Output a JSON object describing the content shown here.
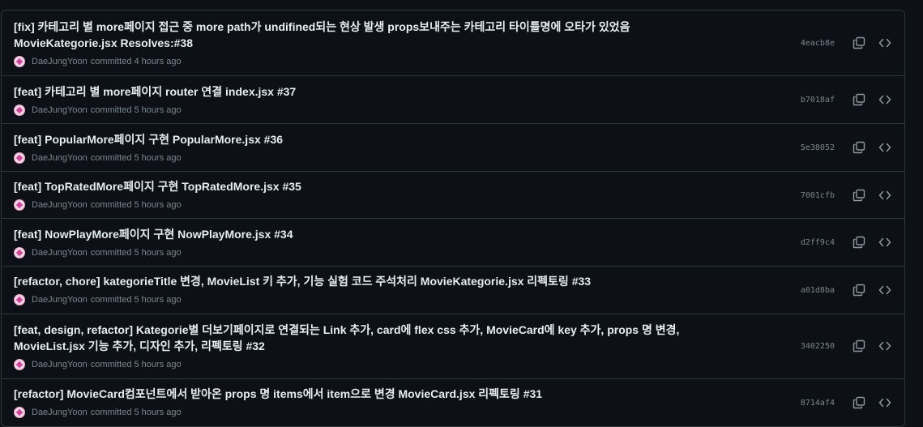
{
  "commits": [
    {
      "title_line1": "[fix] 카테고리 별 more페이지 접근 중 more path가 undifined되는 현상 발생 props보내주는 카테고리 타이틀명에 오타가 있었음",
      "title_line2": "MovieKategorie.jsx Resolves:#38",
      "author": "DaeJungYoon",
      "committed": "committed 4 hours ago",
      "sha": "4eacb8e"
    },
    {
      "title_line1": "[feat] 카테고리 별 more페이지 router 연결 index.jsx #37",
      "title_line2": "",
      "author": "DaeJungYoon",
      "committed": "committed 5 hours ago",
      "sha": "b7018af"
    },
    {
      "title_line1": "[feat] PopularMore페이지 구현 PopularMore.jsx #36",
      "title_line2": "",
      "author": "DaeJungYoon",
      "committed": "committed 5 hours ago",
      "sha": "5e38052"
    },
    {
      "title_line1": "[feat] TopRatedMore페이지 구현 TopRatedMore.jsx #35",
      "title_line2": "",
      "author": "DaeJungYoon",
      "committed": "committed 5 hours ago",
      "sha": "7001cfb"
    },
    {
      "title_line1": "[feat] NowPlayMore페이지 구현 NowPlayMore.jsx #34",
      "title_line2": "",
      "author": "DaeJungYoon",
      "committed": "committed 5 hours ago",
      "sha": "d2ff9c4"
    },
    {
      "title_line1": "[refactor, chore] kategorieTitle 변경, MovieList 키 추가, 기능 실험 코드 주석처리 MovieKategorie.jsx 리펙토링 #33",
      "title_line2": "",
      "author": "DaeJungYoon",
      "committed": "committed 5 hours ago",
      "sha": "a01d8ba"
    },
    {
      "title_line1": "[feat, design, refactor] Kategorie별 더보기페이지로 연결되는 Link 추가, card에 flex css 추가, MovieCard에 key 추가, props 명 변경,",
      "title_line2": "MovieList.jsx 기능 추가, 디자인 추가, 리펙토링 #32",
      "author": "DaeJungYoon",
      "committed": "committed 5 hours ago",
      "sha": "3402250"
    },
    {
      "title_line1": "[refactor] MovieCard컴포넌트에서 받아온 props 명 items에서 item으로 변경 MovieCard.jsx 리펙토링 #31",
      "title_line2": "",
      "author": "DaeJungYoon",
      "committed": "committed 5 hours ago",
      "sha": "8714af4"
    }
  ],
  "icons": {
    "copy": "copy-icon",
    "browse": "code-icon",
    "avatar": "avatar"
  },
  "colors": {
    "background": "#0d1117",
    "border": "#30363d",
    "title": "#e6edf3",
    "muted": "#7d8590"
  }
}
